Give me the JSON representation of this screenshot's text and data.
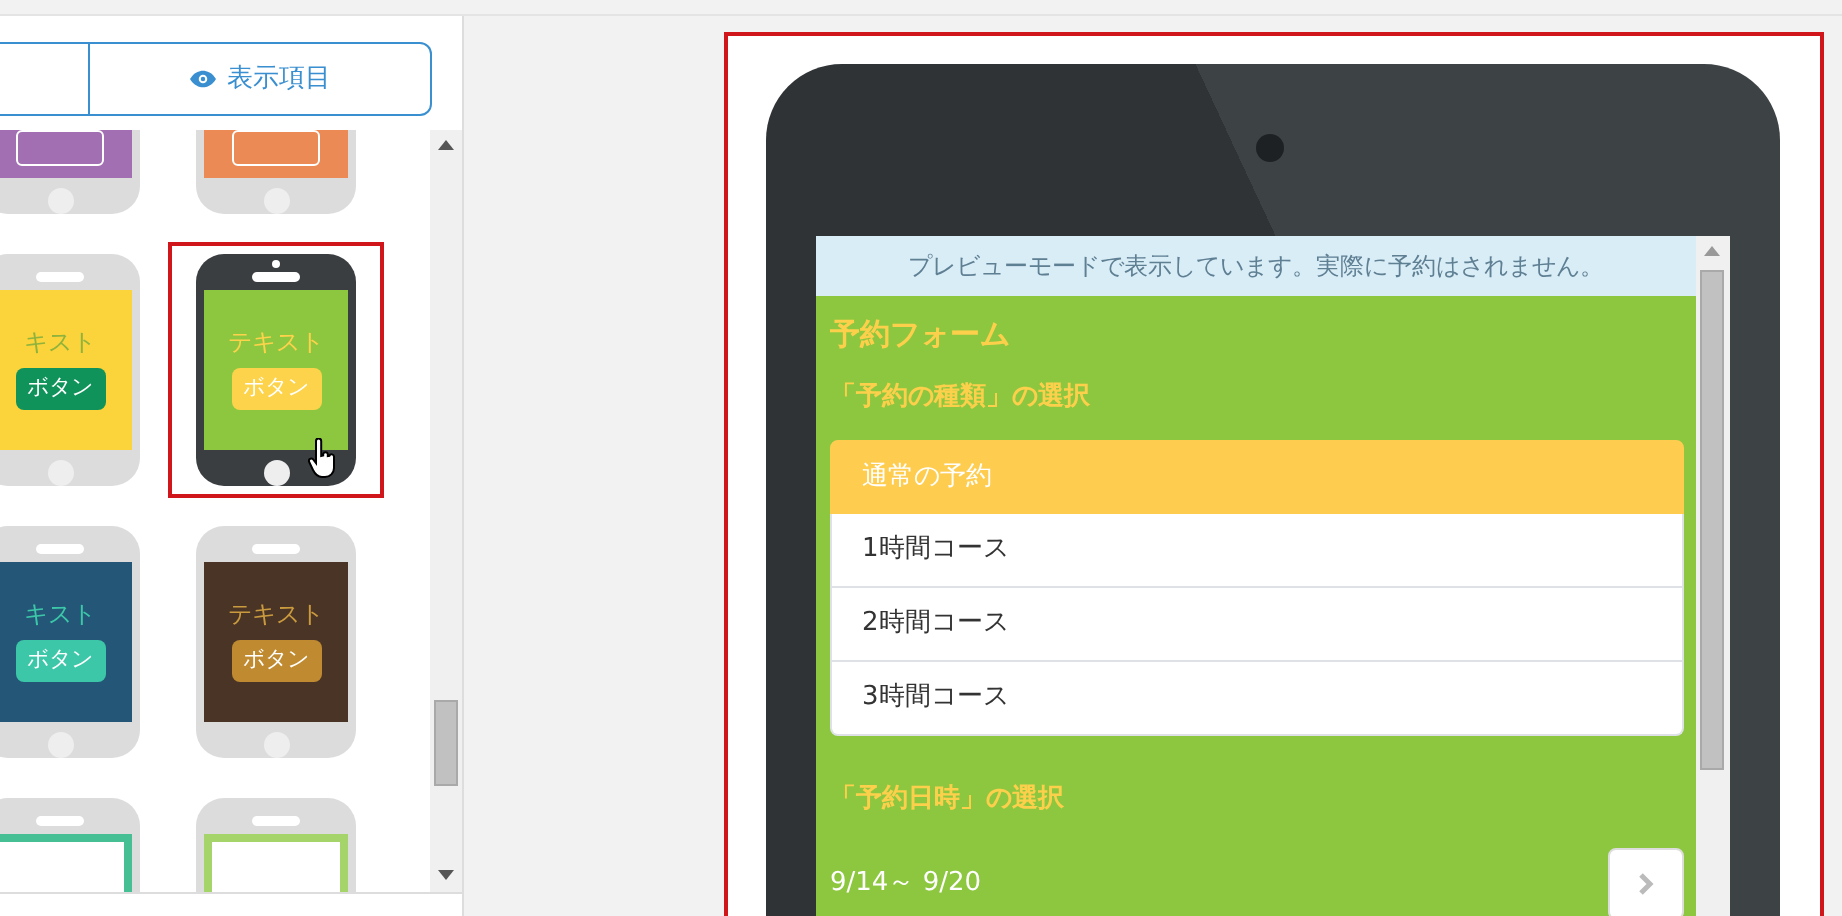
{
  "sidebar": {
    "view_button": {
      "label": "表示項目"
    },
    "themes": [
      {
        "color": "#a26fb3",
        "selected": false
      },
      {
        "color": "#ec8a55",
        "selected": false
      },
      {
        "color": "#fbd33a",
        "text": {
          "label": "キスト",
          "color": "#8fb33c"
        },
        "button": {
          "label": "ボタン",
          "color": "#0f935a"
        },
        "selected": false
      },
      {
        "color": "#8dc63f",
        "text": {
          "label": "テキスト",
          "color": "#fcd34a"
        },
        "button": {
          "label": "ボタン",
          "color": "#fcd34a"
        },
        "selected": true
      },
      {
        "color": "#245677",
        "text": {
          "label": "キスト",
          "color": "#3cc8a8"
        },
        "button": {
          "label": "ボタン",
          "color": "#3cc8a8"
        },
        "selected": false
      },
      {
        "color": "#4a3426",
        "text": {
          "label": "テキスト",
          "color": "#c99a3e"
        },
        "button": {
          "label": "ボタン",
          "color": "#c08a30"
        },
        "selected": false
      },
      {
        "color": "#47bf95",
        "selected": false
      },
      {
        "color": "#a5d46a",
        "selected": false
      }
    ]
  },
  "preview": {
    "notice": "プレビューモードで表示しています。実際に予約はされません。",
    "title": "予約フォーム",
    "sections": [
      {
        "heading": "「予約の種類」の選択",
        "options": [
          {
            "label": "通常の予約",
            "selected": true
          },
          {
            "label": "1時間コース",
            "selected": false
          },
          {
            "label": "2時間コース",
            "selected": false
          },
          {
            "label": "3時間コース",
            "selected": false
          }
        ]
      },
      {
        "heading": "「予約日時」の選択",
        "week": "9/14～ 9/20"
      }
    ]
  }
}
